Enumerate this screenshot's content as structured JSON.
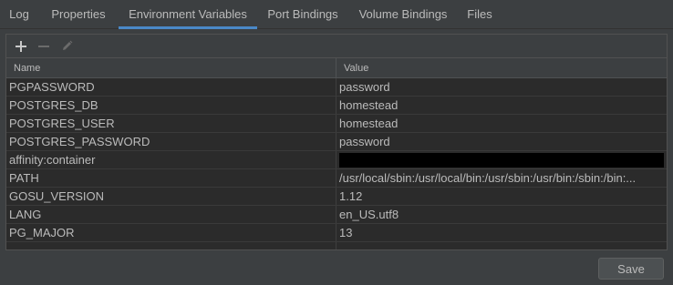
{
  "tabs": [
    {
      "label": "Log"
    },
    {
      "label": "Properties"
    },
    {
      "label": "Environment Variables",
      "active": true
    },
    {
      "label": "Port Bindings"
    },
    {
      "label": "Volume Bindings"
    },
    {
      "label": "Files"
    }
  ],
  "toolbar": {
    "add_icon": "plus-icon",
    "remove_icon": "minus-icon",
    "edit_icon": "pencil-icon"
  },
  "table": {
    "headers": {
      "name": "Name",
      "value": "Value"
    },
    "rows": [
      {
        "name": "PGPASSWORD",
        "value": "password"
      },
      {
        "name": "POSTGRES_DB",
        "value": "homestead"
      },
      {
        "name": "POSTGRES_USER",
        "value": "homestead"
      },
      {
        "name": "POSTGRES_PASSWORD",
        "value": "password"
      },
      {
        "name": "affinity:container",
        "value": ""
      },
      {
        "name": "PATH",
        "value": "/usr/local/sbin:/usr/local/bin:/usr/sbin:/usr/bin:/sbin:/bin:..."
      },
      {
        "name": "GOSU_VERSION",
        "value": "1.12"
      },
      {
        "name": "LANG",
        "value": "en_US.utf8"
      },
      {
        "name": "PG_MAJOR",
        "value": "13"
      }
    ]
  },
  "save_label": "Save",
  "colors": {
    "background": "#3c3f41",
    "table_row": "#2b2b2b",
    "accent": "#4a88c7",
    "text": "#bbbbbb"
  }
}
